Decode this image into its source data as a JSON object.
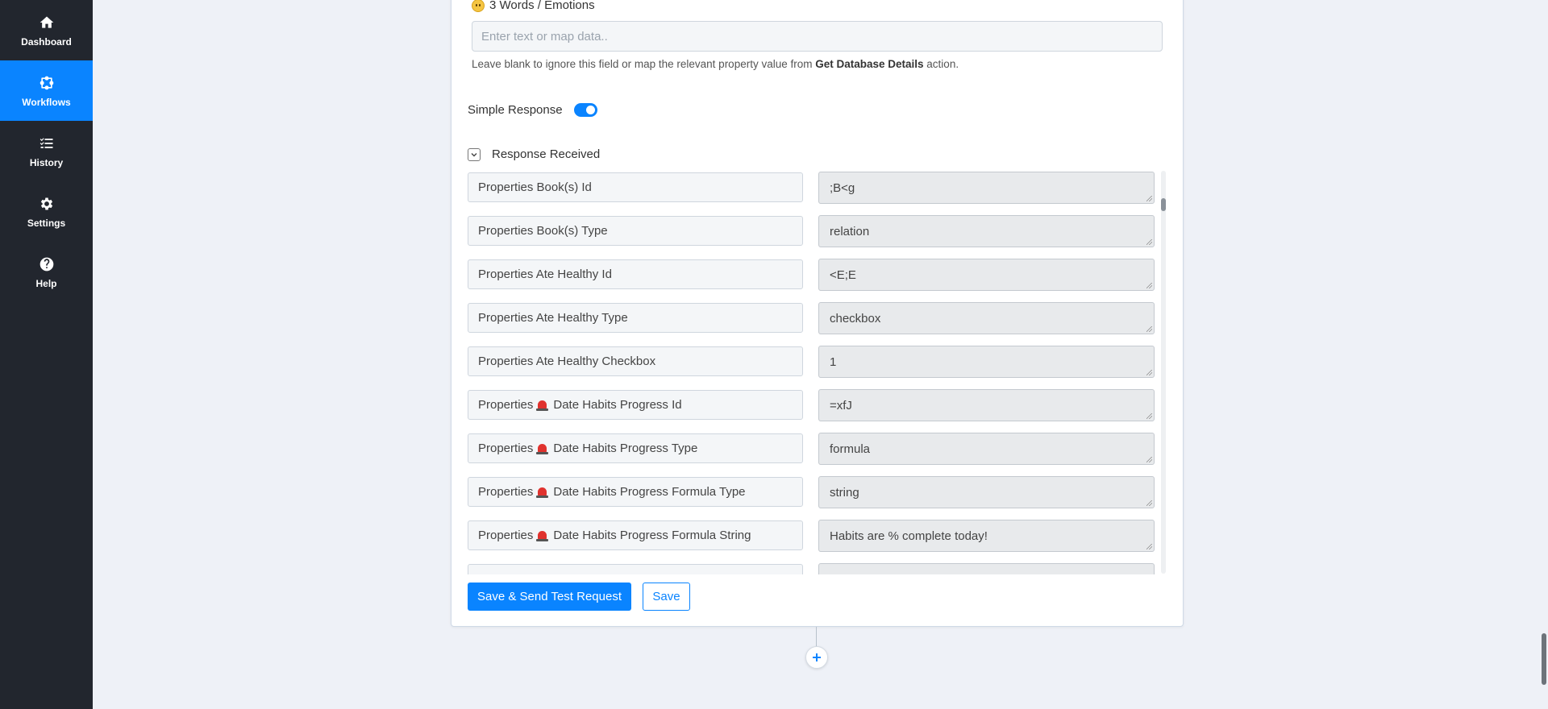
{
  "sidebar": {
    "items": [
      {
        "label": "Dashboard",
        "icon": "home-icon",
        "active": false
      },
      {
        "label": "Workflows",
        "icon": "workflow-icon",
        "active": true
      },
      {
        "label": "History",
        "icon": "list-check-icon",
        "active": false
      },
      {
        "label": "Settings",
        "icon": "gear-icon",
        "active": false
      },
      {
        "label": "Help",
        "icon": "question-circle-icon",
        "active": false
      }
    ]
  },
  "form": {
    "field_title": "3 Words / Emotions",
    "field_placeholder": "Enter text or map data..",
    "hint_prefix": "Leave blank to ignore this field or map the relevant property value from ",
    "hint_bold": "Get Database Details",
    "hint_suffix": " action.",
    "simple_response_label": "Simple Response",
    "simple_response_enabled": true,
    "response_received_label": "Response Received",
    "response_received_expanded": true
  },
  "response_rows": [
    {
      "prefix": "Properties Book(s) Id",
      "siren": false,
      "rest": "",
      "value": ";B<g"
    },
    {
      "prefix": "Properties Book(s) Type",
      "siren": false,
      "rest": "",
      "value": "relation"
    },
    {
      "prefix": "Properties Ate Healthy Id",
      "siren": false,
      "rest": "",
      "value": "<E;E"
    },
    {
      "prefix": "Properties Ate Healthy Type",
      "siren": false,
      "rest": "",
      "value": "checkbox"
    },
    {
      "prefix": "Properties Ate Healthy Checkbox",
      "siren": false,
      "rest": "",
      "value": "1"
    },
    {
      "prefix": "Properties",
      "siren": true,
      "rest": "Date Habits Progress Id",
      "value": "=xfJ"
    },
    {
      "prefix": "Properties",
      "siren": true,
      "rest": "Date Habits Progress Type",
      "value": "formula"
    },
    {
      "prefix": "Properties",
      "siren": true,
      "rest": "Date Habits Progress Formula Type",
      "value": "string"
    },
    {
      "prefix": "Properties",
      "siren": true,
      "rest": "Date Habits Progress Formula String",
      "value": "Habits are % complete today!"
    },
    {
      "prefix": "",
      "siren": false,
      "rest": "",
      "value": ""
    }
  ],
  "buttons": {
    "save_test": "Save & Send Test Request",
    "save": "Save"
  },
  "colors": {
    "accent": "#0a84ff",
    "sidebar_bg": "#22262e",
    "page_bg": "#eef1f7"
  }
}
